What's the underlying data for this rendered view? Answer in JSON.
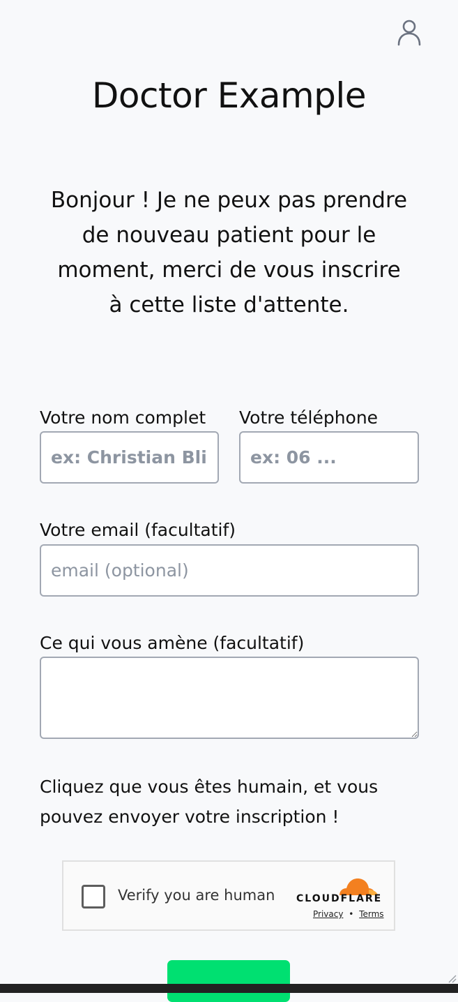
{
  "header": {
    "title": "Doctor Example",
    "intro": "Bonjour ! Je ne peux pas prendre de nouveau patient pour le moment, merci de vous inscrire à cette liste d'attente."
  },
  "form": {
    "name_label": "Votre nom complet",
    "name_placeholder": "ex: Christian Blinker",
    "phone_label": "Votre téléphone",
    "phone_placeholder": "ex: 06 ...",
    "email_label": "Votre email (facultatif)",
    "email_placeholder": "email (optional)",
    "reason_label": "Ce qui vous amène (facultatif)",
    "reason_value": "",
    "human_text": "Cliquez que vous êtes humain, et vous pouvez envoyer votre inscription !"
  },
  "captcha": {
    "label": "Verify you are human",
    "brand": "CLOUDFLARE",
    "privacy": "Privacy",
    "separator": "•",
    "terms": "Terms",
    "brand_color": "#f38020"
  },
  "icons": {
    "profile": "user-profile-icon",
    "brand": "cloudflare-logo-icon"
  },
  "colors": {
    "accent": "#00e071",
    "background": "#f8f9fb",
    "border": "#a2a8b3"
  }
}
